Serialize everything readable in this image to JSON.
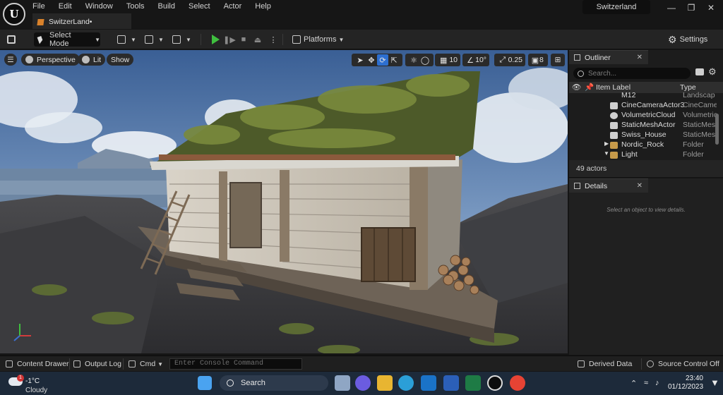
{
  "window": {
    "logo": "U",
    "project": "Switzerland"
  },
  "menu": [
    "File",
    "Edit",
    "Window",
    "Tools",
    "Build",
    "Select",
    "Actor",
    "Help"
  ],
  "doc_tab": "SwitzerLand•",
  "toolbar": {
    "select_mode": "Select Mode",
    "platforms": "Platforms",
    "settings": "Settings"
  },
  "viewport": {
    "perspective": "Perspective",
    "lit": "Lit",
    "show": "Show",
    "grid_snap": "10",
    "rot_snap": "10°",
    "scale_snap": "0.25",
    "cam_speed": "8"
  },
  "outliner": {
    "title": "Outliner",
    "search_placeholder": "Search...",
    "col_label": "Item Label",
    "col_type": "Type",
    "rows": [
      {
        "label": "M12",
        "type": "Landscap"
      },
      {
        "label": "CineCameraActor3",
        "type": "CineCame"
      },
      {
        "label": "VolumetricCloud",
        "type": "Volumetric"
      },
      {
        "label": "StaticMeshActor",
        "type": "StaticMes"
      },
      {
        "label": "Swiss_House",
        "type": "StaticMes"
      },
      {
        "label": "Nordic_Rock",
        "type": "Folder"
      },
      {
        "label": "Light",
        "type": "Folder"
      }
    ],
    "count": "49 actors"
  },
  "details": {
    "title": "Details",
    "empty": "Select an object to view details."
  },
  "bottom": {
    "content_drawer": "Content Drawer",
    "output_log": "Output Log",
    "cmd": "Cmd",
    "console_placeholder": "Enter Console Command",
    "derived_data": "Derived Data",
    "source_control": "Source Control Off"
  },
  "taskbar": {
    "weather_temp": "-1°C",
    "weather_cond": "Cloudy",
    "weather_badge": "1",
    "search": "Search",
    "time": "23:40",
    "date": "01/12/2023"
  },
  "colors": {
    "accent": "#2d6fd0",
    "play": "#3fbf3f",
    "taskbar": "#1d2a3a"
  }
}
